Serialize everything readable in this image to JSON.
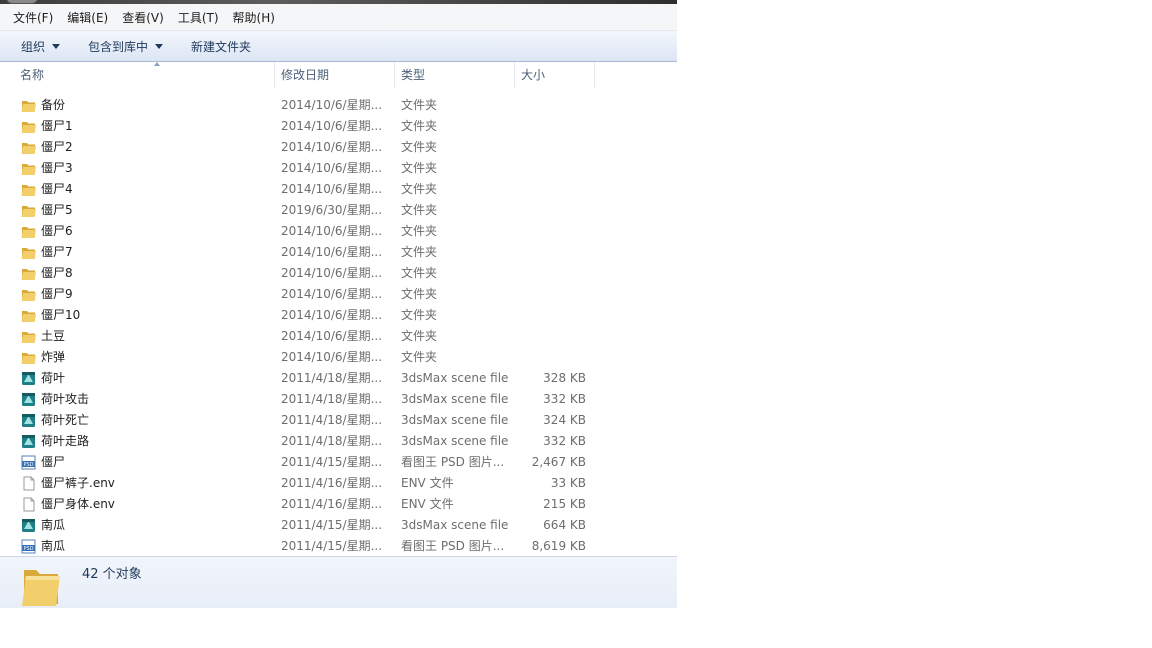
{
  "menu": [
    "文件(F)",
    "编辑(E)",
    "查看(V)",
    "工具(T)",
    "帮助(H)"
  ],
  "toolbar": {
    "organize": "组织",
    "include_library": "包含到库中",
    "new_folder": "新建文件夹"
  },
  "columns": {
    "name": "名称",
    "date": "修改日期",
    "type": "类型",
    "size": "大小"
  },
  "files": [
    {
      "name": "备份",
      "date": "2014/10/6/星期...",
      "type": "文件夹",
      "size": "",
      "icon": "folder-icon"
    },
    {
      "name": "僵尸1",
      "date": "2014/10/6/星期...",
      "type": "文件夹",
      "size": "",
      "icon": "folder-icon"
    },
    {
      "name": "僵尸2",
      "date": "2014/10/6/星期...",
      "type": "文件夹",
      "size": "",
      "icon": "folder-icon"
    },
    {
      "name": "僵尸3",
      "date": "2014/10/6/星期...",
      "type": "文件夹",
      "size": "",
      "icon": "folder-icon"
    },
    {
      "name": "僵尸4",
      "date": "2014/10/6/星期...",
      "type": "文件夹",
      "size": "",
      "icon": "folder-icon"
    },
    {
      "name": "僵尸5",
      "date": "2019/6/30/星期...",
      "type": "文件夹",
      "size": "",
      "icon": "folder-icon"
    },
    {
      "name": "僵尸6",
      "date": "2014/10/6/星期...",
      "type": "文件夹",
      "size": "",
      "icon": "folder-icon"
    },
    {
      "name": "僵尸7",
      "date": "2014/10/6/星期...",
      "type": "文件夹",
      "size": "",
      "icon": "folder-icon"
    },
    {
      "name": "僵尸8",
      "date": "2014/10/6/星期...",
      "type": "文件夹",
      "size": "",
      "icon": "folder-icon"
    },
    {
      "name": "僵尸9",
      "date": "2014/10/6/星期...",
      "type": "文件夹",
      "size": "",
      "icon": "folder-icon"
    },
    {
      "name": "僵尸10",
      "date": "2014/10/6/星期...",
      "type": "文件夹",
      "size": "",
      "icon": "folder-icon"
    },
    {
      "name": "土豆",
      "date": "2014/10/6/星期...",
      "type": "文件夹",
      "size": "",
      "icon": "folder-icon"
    },
    {
      "name": "炸弹",
      "date": "2014/10/6/星期...",
      "type": "文件夹",
      "size": "",
      "icon": "folder-icon"
    },
    {
      "name": "荷叶",
      "date": "2011/4/18/星期...",
      "type": "3dsMax scene file",
      "size": "328 KB",
      "icon": "max-file-icon"
    },
    {
      "name": "荷叶攻击",
      "date": "2011/4/18/星期...",
      "type": "3dsMax scene file",
      "size": "332 KB",
      "icon": "max-file-icon"
    },
    {
      "name": "荷叶死亡",
      "date": "2011/4/18/星期...",
      "type": "3dsMax scene file",
      "size": "324 KB",
      "icon": "max-file-icon"
    },
    {
      "name": "荷叶走路",
      "date": "2011/4/18/星期...",
      "type": "3dsMax scene file",
      "size": "332 KB",
      "icon": "max-file-icon"
    },
    {
      "name": "僵尸",
      "date": "2011/4/15/星期...",
      "type": "看图王 PSD 图片...",
      "size": "2,467 KB",
      "icon": "psd-file-icon"
    },
    {
      "name": "僵尸裤子.env",
      "date": "2011/4/16/星期...",
      "type": "ENV 文件",
      "size": "33 KB",
      "icon": "generic-file-icon"
    },
    {
      "name": "僵尸身体.env",
      "date": "2011/4/16/星期...",
      "type": "ENV 文件",
      "size": "215 KB",
      "icon": "generic-file-icon"
    },
    {
      "name": "南瓜",
      "date": "2011/4/15/星期...",
      "type": "3dsMax scene file",
      "size": "664 KB",
      "icon": "max-file-icon"
    },
    {
      "name": "南瓜",
      "date": "2011/4/15/星期...",
      "type": "看图王 PSD 图片...",
      "size": "8,619 KB",
      "icon": "psd-file-icon"
    }
  ],
  "status": {
    "count": "42 个对象",
    "icon": "folder-icon"
  },
  "colors": {
    "folder": "#e8c35a",
    "max_icon": "#1f7f86",
    "psd_icon": "#2f6fb4",
    "toolbar_text": "#1e395b"
  }
}
